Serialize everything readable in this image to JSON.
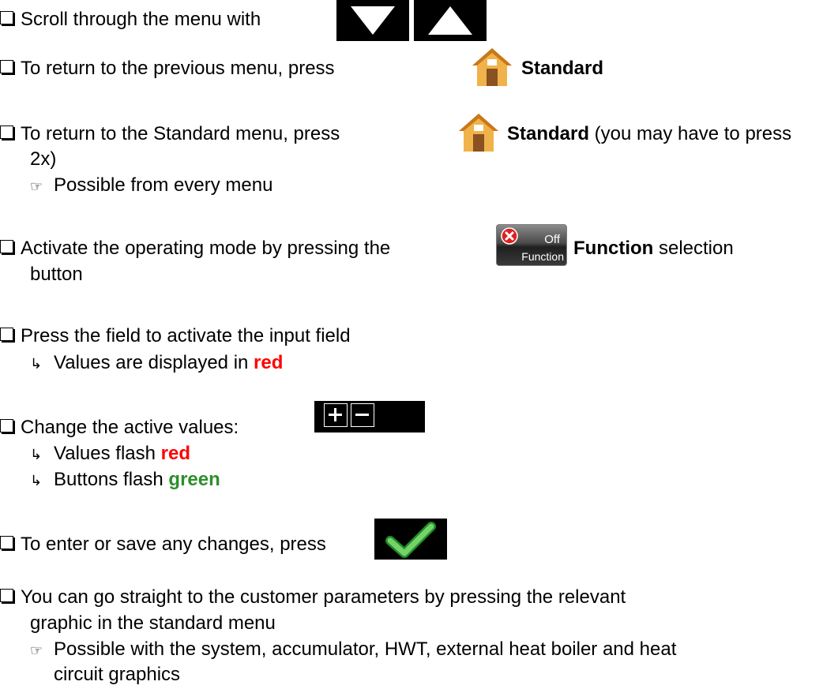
{
  "items": [
    {
      "text": "Scroll through the menu with"
    },
    {
      "text": "To return to the previous menu, press",
      "bold": "Standard"
    },
    {
      "text": "To return to the Standard menu, press",
      "bold": "Standard",
      "after": " (you may have to press",
      "line2": "2x)",
      "note": "Possible from every menu"
    },
    {
      "text": "Activate the operating mode by pressing the",
      "bold": "Function",
      "after": " selection",
      "line2": "button",
      "button": {
        "state": "Off",
        "label": "Function"
      }
    },
    {
      "text": "Press the field to activate the input field",
      "result_pre": "Values are displayed in ",
      "result_color": "red"
    },
    {
      "text": "Change the active values:",
      "results": [
        {
          "pre": "Values flash ",
          "color": "red"
        },
        {
          "pre": "Buttons flash ",
          "color": "green"
        }
      ]
    },
    {
      "text": "To enter or save any changes, press"
    },
    {
      "text": "You can go straight to the customer parameters by pressing the relevant",
      "line2": "graphic in the standard menu",
      "note": "Possible with the system, accumulator, HWT, external heat boiler and heat",
      "note2": "circuit graphics"
    }
  ],
  "icons": {
    "checkbox": "checkbox-icon",
    "hint": "pointing-hand-icon",
    "result": "arrow-result-icon",
    "down": "triangle-down-icon",
    "up": "triangle-up-icon",
    "home": "house-icon",
    "confirm": "checkmark-icon",
    "plus": "plus-icon",
    "minus": "minus-icon",
    "cancel": "x-circle-icon"
  },
  "glyphs": {
    "hint": "☞",
    "result": "↳"
  },
  "colors": {
    "red": "#ff0000",
    "green": "#2c8f2c",
    "button_bg": "#000000"
  }
}
